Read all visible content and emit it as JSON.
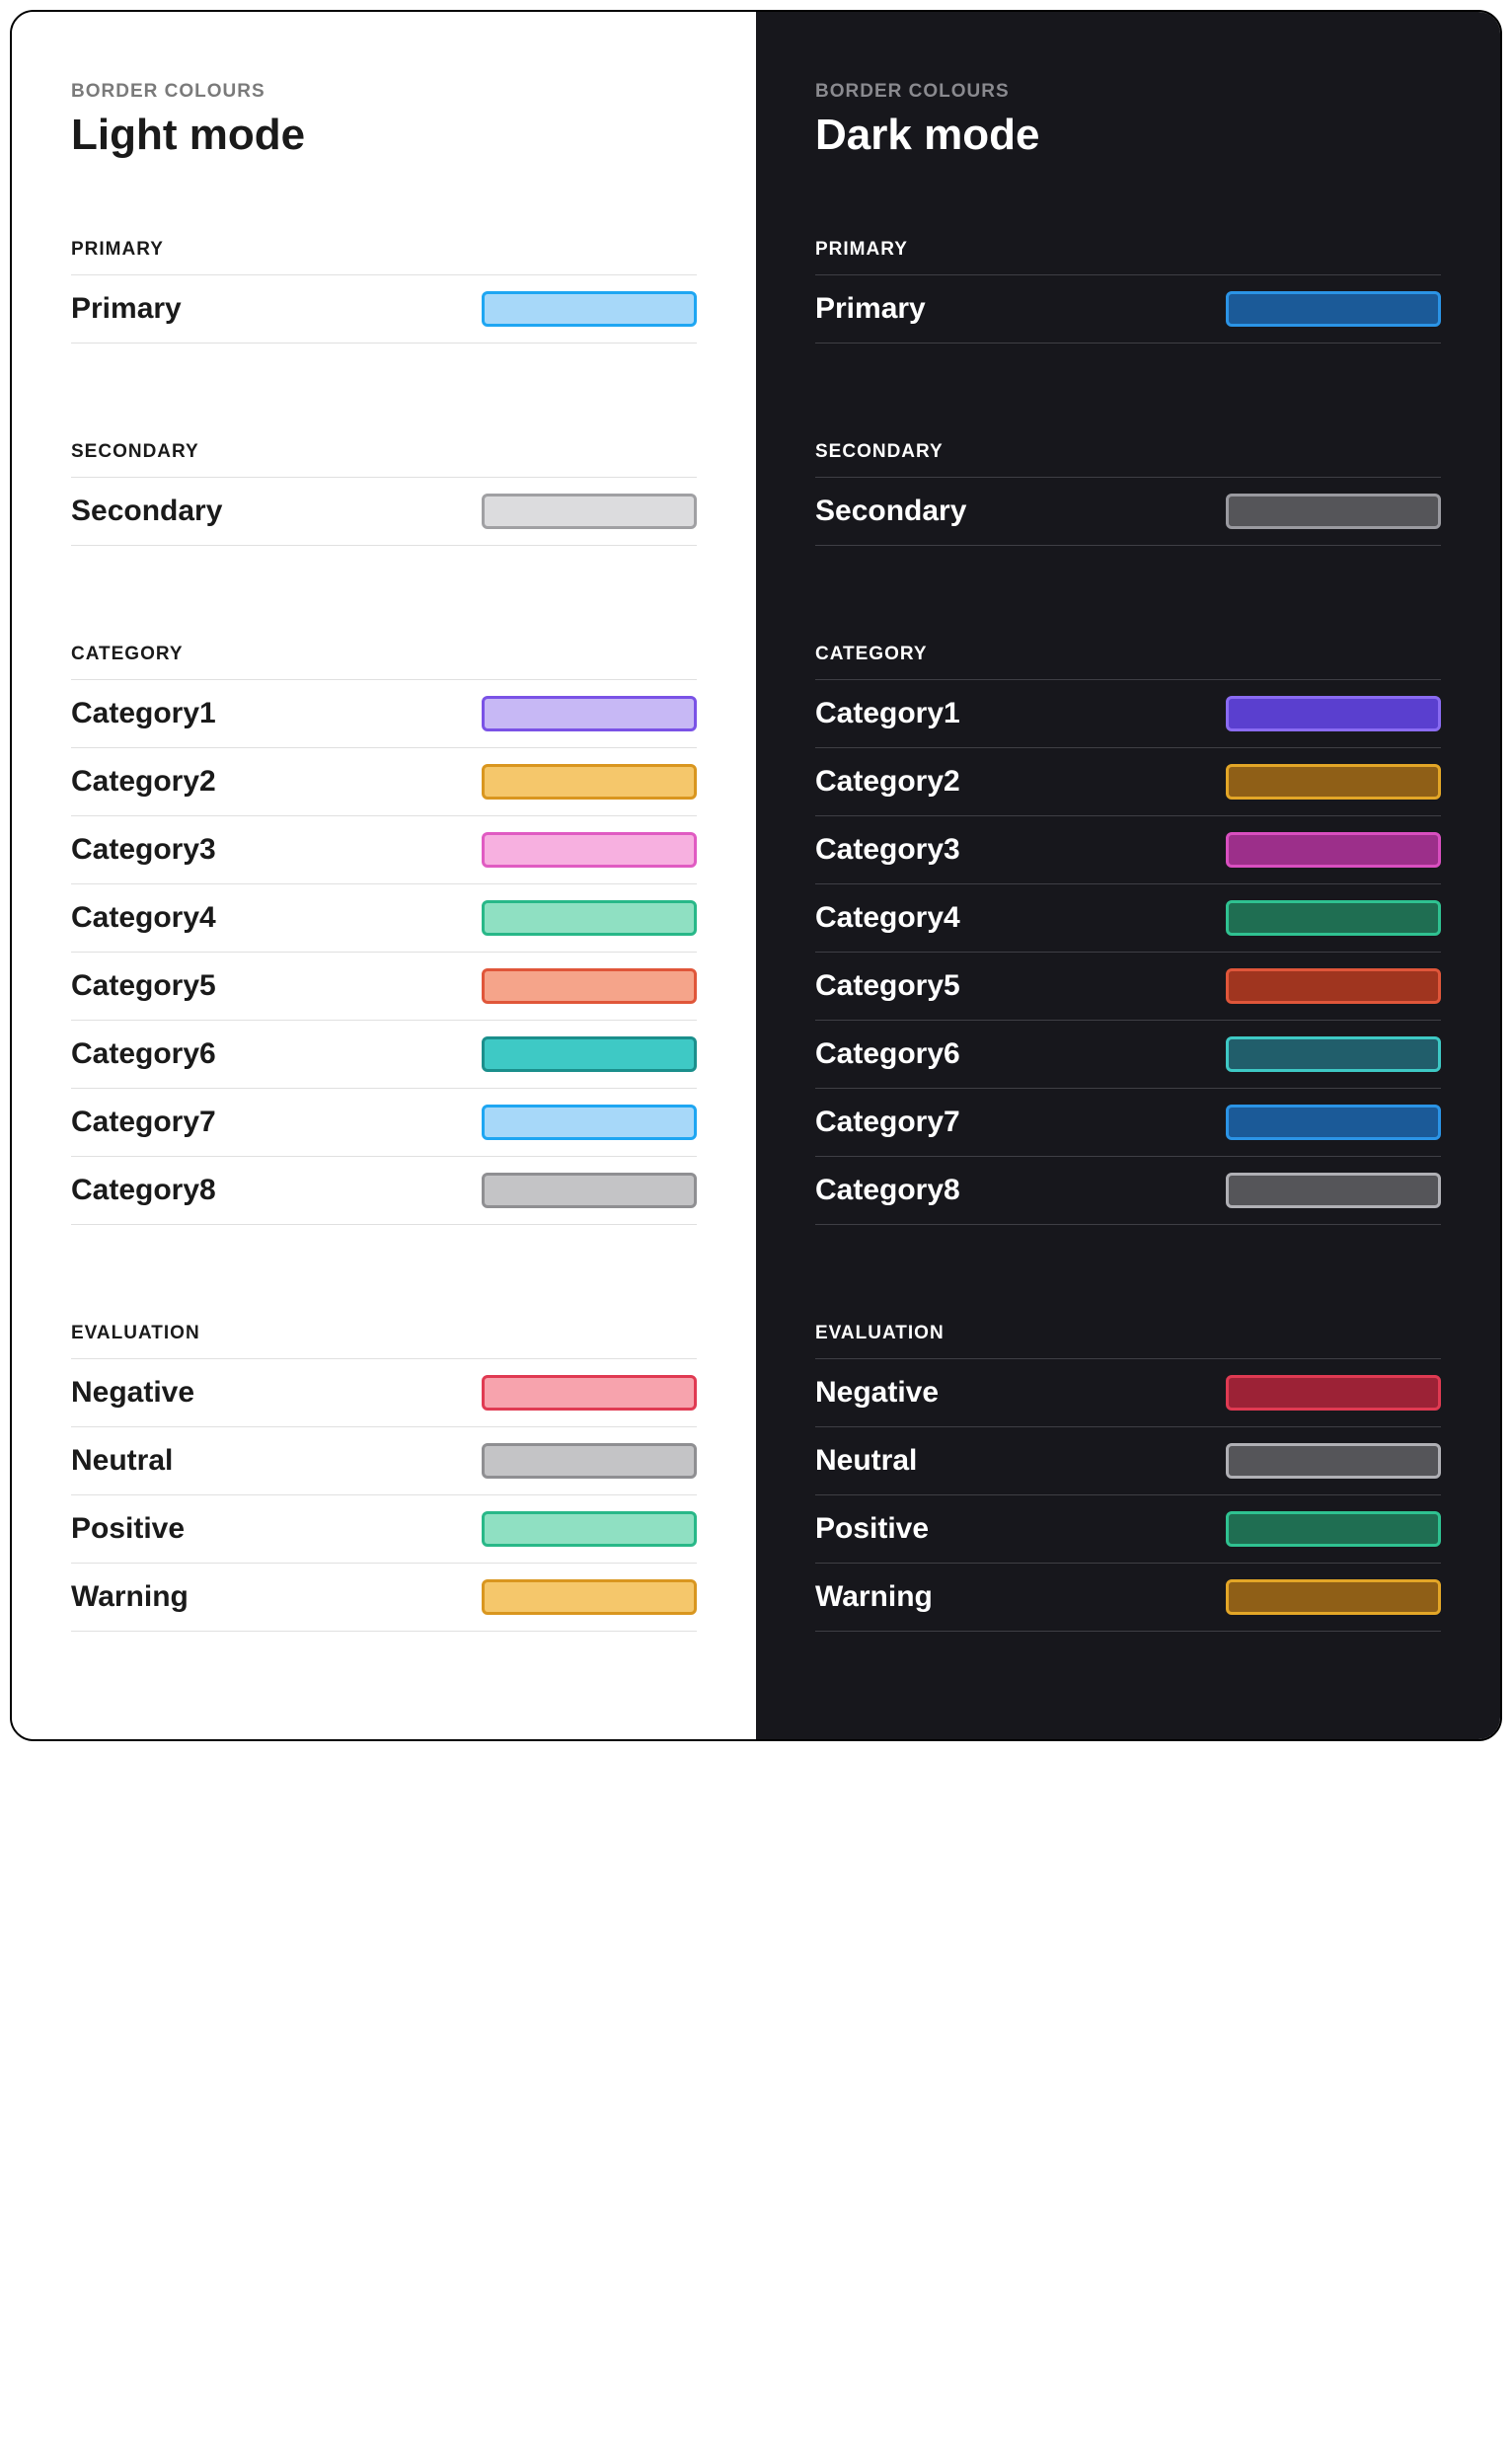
{
  "eyebrow": "BORDER COLOURS",
  "titles": {
    "light": "Light mode",
    "dark": "Dark mode"
  },
  "sections": [
    {
      "name": "PRIMARY",
      "rows": [
        {
          "label": "Primary",
          "light": {
            "fill": "#a7d8f9",
            "border": "#1ea6f2"
          },
          "dark": {
            "fill": "#1b5a98",
            "border": "#2b94e6"
          }
        }
      ]
    },
    {
      "name": "SECONDARY",
      "rows": [
        {
          "label": "Secondary",
          "light": {
            "fill": "#dcdcde",
            "border": "#a0a0a3"
          },
          "dark": {
            "fill": "#555559",
            "border": "#9a9aa0"
          }
        }
      ]
    },
    {
      "name": "CATEGORY",
      "rows": [
        {
          "label": "Category1",
          "light": {
            "fill": "#c7b8f5",
            "border": "#7a52e6"
          },
          "dark": {
            "fill": "#5a3fcf",
            "border": "#8a6bf2"
          }
        },
        {
          "label": "Category2",
          "light": {
            "fill": "#f5c76b",
            "border": "#d9961f"
          },
          "dark": {
            "fill": "#8f5f17",
            "border": "#e3a627"
          }
        },
        {
          "label": "Category3",
          "light": {
            "fill": "#f7b0e0",
            "border": "#e05bc2"
          },
          "dark": {
            "fill": "#9c2f8a",
            "border": "#d94fc0"
          }
        },
        {
          "label": "Category4",
          "light": {
            "fill": "#8fe0c2",
            "border": "#28b888"
          },
          "dark": {
            "fill": "#1f6e52",
            "border": "#2fc291"
          }
        },
        {
          "label": "Category5",
          "light": {
            "fill": "#f5a48a",
            "border": "#e0563a"
          },
          "dark": {
            "fill": "#a0351f",
            "border": "#e0563a"
          }
        },
        {
          "label": "Category6",
          "light": {
            "fill": "#3ec9c5",
            "border": "#1b8f8c"
          },
          "dark": {
            "fill": "#215e6b",
            "border": "#3ec9c5"
          }
        },
        {
          "label": "Category7",
          "light": {
            "fill": "#a7d8f9",
            "border": "#1ea6f2"
          },
          "dark": {
            "fill": "#1b5a98",
            "border": "#2b94e6"
          }
        },
        {
          "label": "Category8",
          "light": {
            "fill": "#c4c4c6",
            "border": "#8f8f92"
          },
          "dark": {
            "fill": "#555559",
            "border": "#b0b0b5"
          }
        }
      ]
    },
    {
      "name": "EVALUATION",
      "rows": [
        {
          "label": "Negative",
          "light": {
            "fill": "#f7a3ad",
            "border": "#e03a52"
          },
          "dark": {
            "fill": "#9c2236",
            "border": "#e03a52"
          }
        },
        {
          "label": "Neutral",
          "light": {
            "fill": "#c4c4c6",
            "border": "#8f8f92"
          },
          "dark": {
            "fill": "#555559",
            "border": "#b0b0b5"
          }
        },
        {
          "label": "Positive",
          "light": {
            "fill": "#8fe0c2",
            "border": "#28b888"
          },
          "dark": {
            "fill": "#1f6e52",
            "border": "#2fc291"
          }
        },
        {
          "label": "Warning",
          "light": {
            "fill": "#f5c76b",
            "border": "#d9961f"
          },
          "dark": {
            "fill": "#8f5f17",
            "border": "#e3a627"
          }
        }
      ]
    }
  ]
}
